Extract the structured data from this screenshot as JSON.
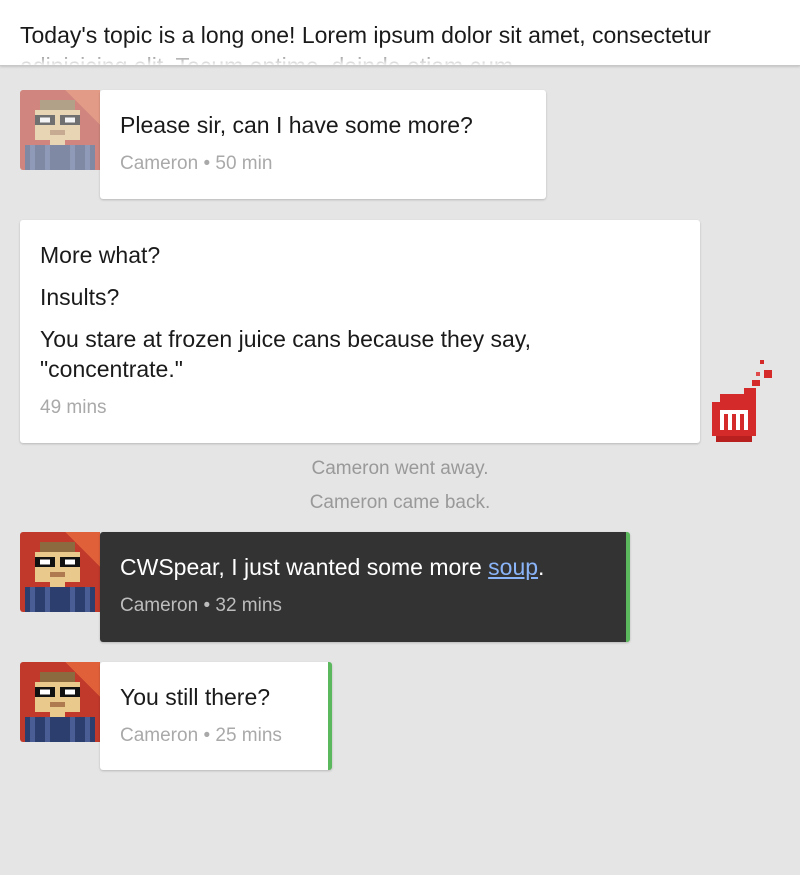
{
  "topic": {
    "text": "Today's topic is a long one! Lorem ipsum dolor sit amet, consectetur adipisicing elit. Tecum optime, deinde etiam cum"
  },
  "messages": [
    {
      "text": "Please sir, can I have some more?",
      "author": "Cameron",
      "time": "50 min"
    },
    {
      "lines": [
        "More what?",
        "Insults?",
        "You stare at frozen juice cans because they say, \"concentrate.\""
      ],
      "time": "49 mins"
    },
    {
      "text_before": "CWSpear, I just wanted some more ",
      "link": "soup",
      "text_after": ".",
      "author": "Cameron",
      "time": "32 mins"
    },
    {
      "text": "You still there?",
      "author": "Cameron",
      "time": "25 mins"
    }
  ],
  "status": {
    "went_away": "Cameron went away.",
    "came_back": "Cameron came back."
  },
  "meta_separator": "•",
  "colors": {
    "background": "#e5e5e5",
    "bubble": "#ffffff",
    "dark_bubble": "#333333",
    "accent_green": "#5cb85c",
    "link": "#8ab4f8",
    "meta_text": "#a9a9a9"
  },
  "icons": {
    "user_avatar": "pixel-avatar-glasses",
    "self_avatar": "red-flame-m-logo"
  }
}
